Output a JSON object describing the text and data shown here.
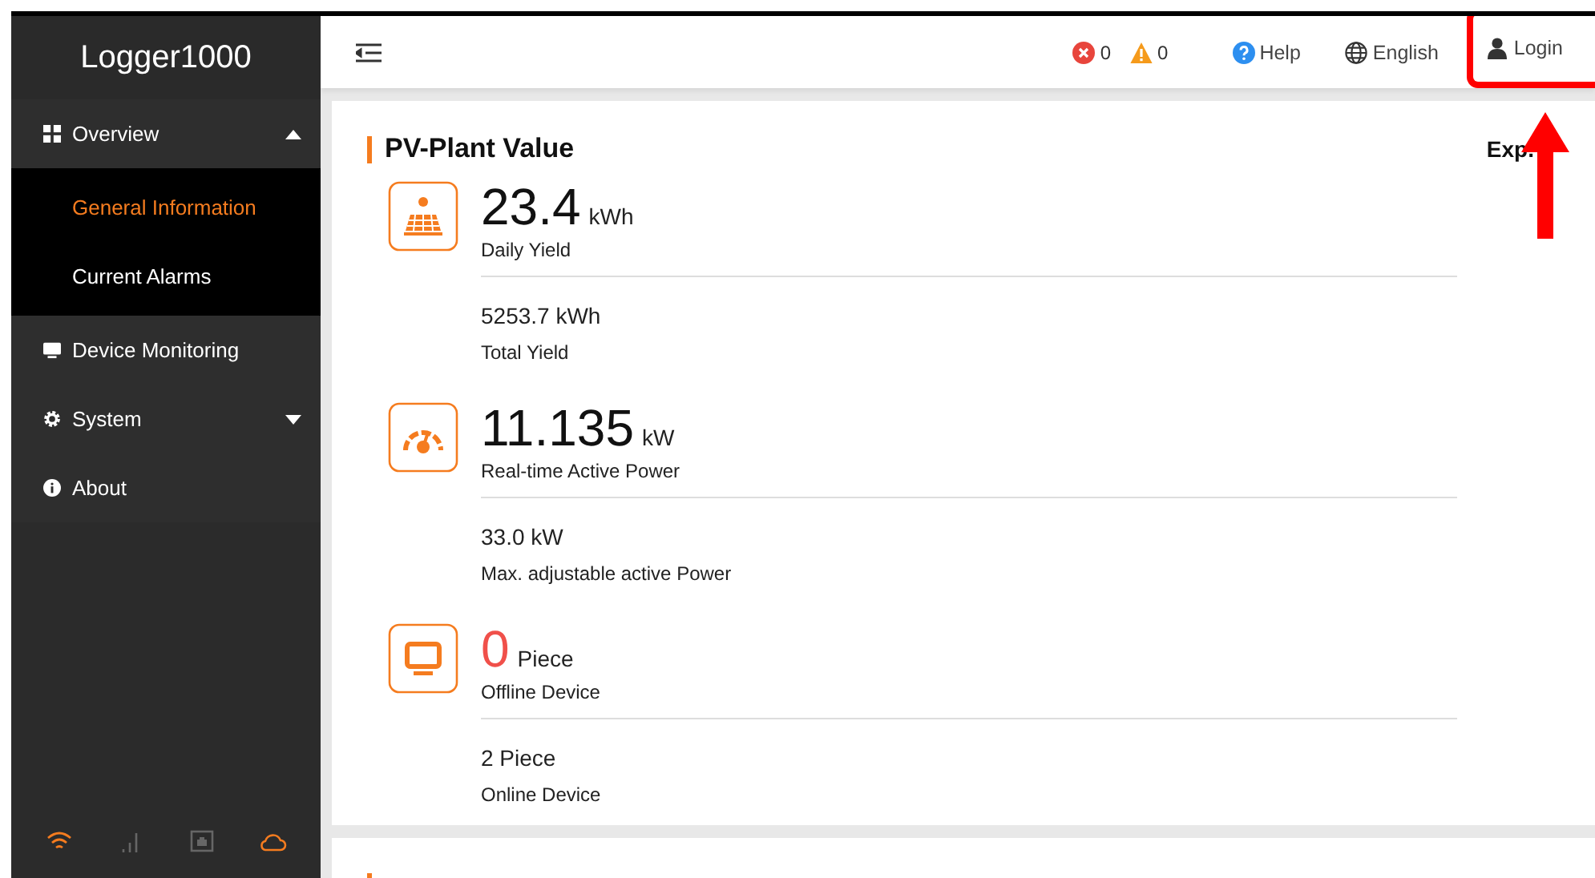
{
  "sidebar": {
    "title": "Logger1000",
    "items": [
      {
        "kind": "grid",
        "label": "Overview",
        "expanded": true,
        "children": [
          {
            "label": "General Information",
            "selected": true
          },
          {
            "label": "Current Alarms",
            "selected": false
          }
        ]
      },
      {
        "kind": "monitor",
        "label": "Device Monitoring"
      },
      {
        "kind": "gear",
        "label": "System",
        "expanded": false
      },
      {
        "kind": "info",
        "label": "About"
      }
    ]
  },
  "header": {
    "alarms": [
      {
        "kind": "error",
        "count": "0"
      },
      {
        "kind": "warning",
        "count": "0"
      }
    ],
    "links": [
      {
        "kind": "help",
        "label": "Help",
        "highlighted": false
      },
      {
        "kind": "language",
        "label": "English",
        "highlighted": false
      },
      {
        "kind": "user",
        "label": "Login",
        "highlighted": true
      }
    ]
  },
  "card": {
    "title": "PV-Plant Value",
    "side_label": "Exp.",
    "metrics": [
      {
        "kind": "solar",
        "value": "23.4",
        "unit": "kWh",
        "label": "Daily Yield",
        "alert": false,
        "secondary_value": "5253.7 kWh",
        "secondary_label": "Total Yield"
      },
      {
        "kind": "gauge",
        "value": "11.135",
        "unit": "kW",
        "label": "Real-time Active Power",
        "alert": false,
        "secondary_value": "33.0 kW",
        "secondary_label": "Max. adjustable active Power"
      },
      {
        "kind": "monitor",
        "value": "0",
        "unit": "Piece",
        "label": "Offline Device",
        "alert": true,
        "secondary_value": "2 Piece",
        "secondary_label": "Online Device"
      }
    ]
  }
}
